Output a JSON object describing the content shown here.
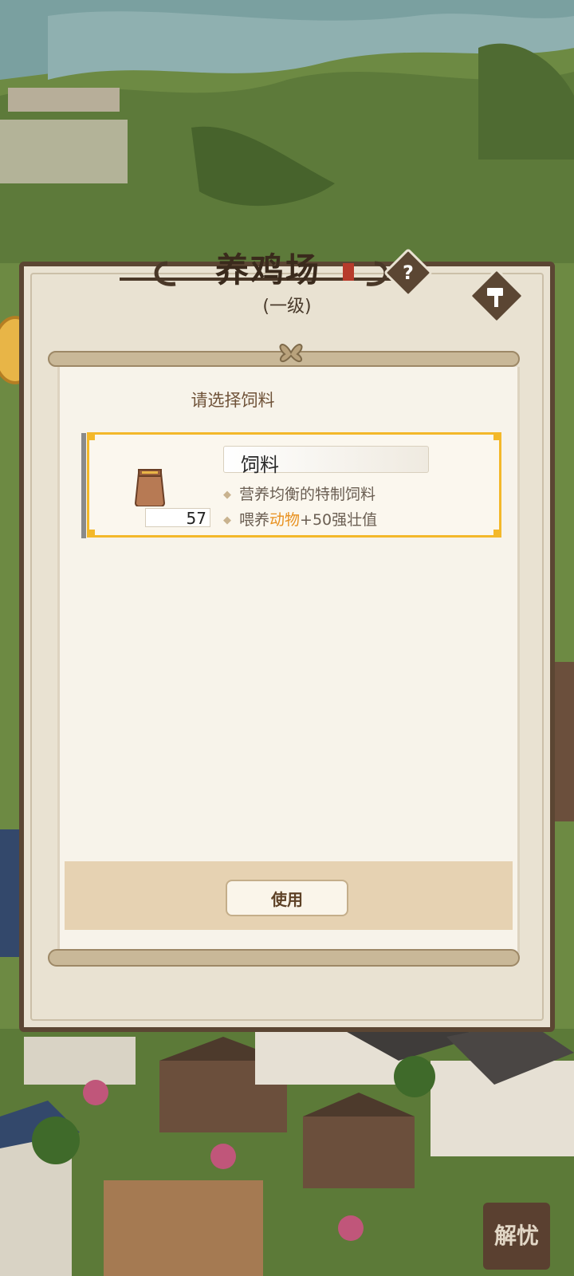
{
  "building": {
    "title": "养鸡场",
    "level": "(一级)"
  },
  "icons": {
    "help": "?",
    "hammer": "hammer-icon",
    "bag": "feed-bag-icon"
  },
  "dialog": {
    "title": "请选择饲料",
    "item": {
      "name": "饲料",
      "count": "57",
      "desc_1": "营养均衡的特制饲料",
      "desc_2_prefix": "喂养",
      "desc_2_highlight": "动物",
      "desc_2_suffix": "+50强壮值"
    },
    "use_button": "使用"
  },
  "seal": {
    "text": "解忧"
  },
  "colors": {
    "highlight": "#f3b82a",
    "accent_text": "#e8901e",
    "panel_border": "#5b4633"
  }
}
